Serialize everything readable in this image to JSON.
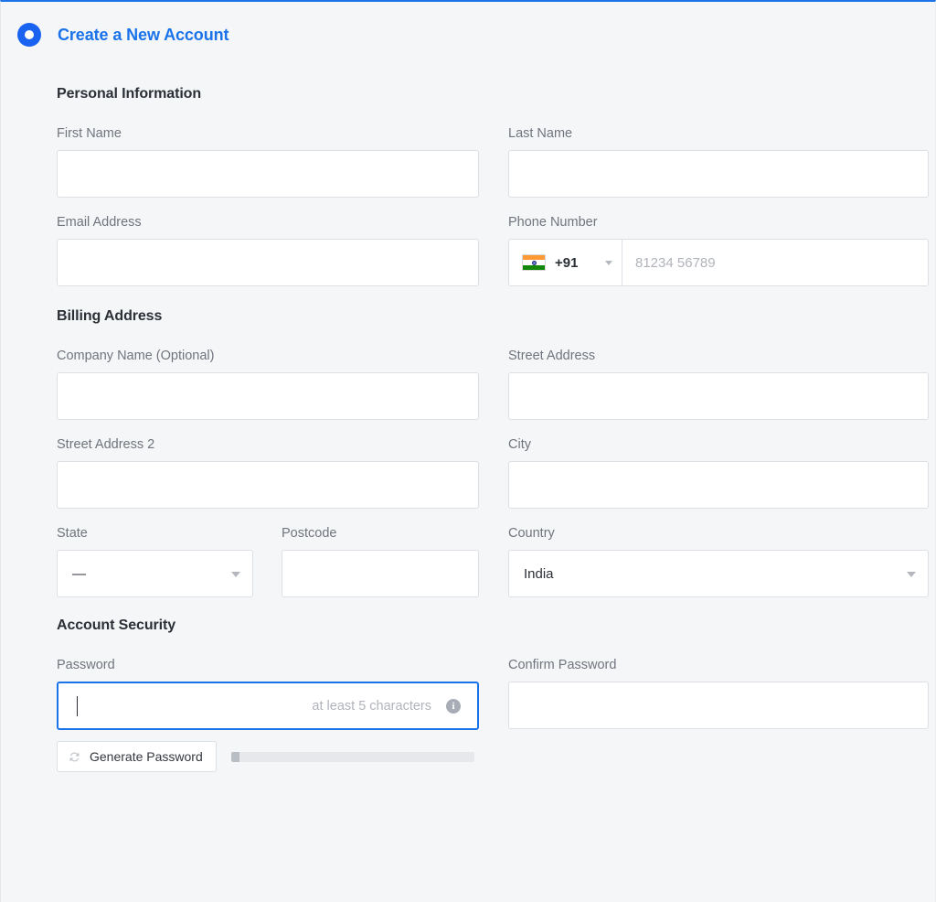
{
  "header": {
    "title": "Create a New Account",
    "radio_selected": true,
    "accent_color": "#1a73e8"
  },
  "sections": {
    "personal": {
      "title": "Personal Information"
    },
    "billing": {
      "title": "Billing Address"
    },
    "security": {
      "title": "Account Security"
    }
  },
  "fields": {
    "first_name": {
      "label": "First Name",
      "value": "",
      "placeholder": ""
    },
    "last_name": {
      "label": "Last Name",
      "value": "",
      "placeholder": ""
    },
    "email": {
      "label": "Email Address",
      "value": "",
      "placeholder": ""
    },
    "phone": {
      "label": "Phone Number",
      "dial_code": "+91",
      "flag": "india-flag-icon",
      "value": "",
      "placeholder": "81234 56789"
    },
    "company_name": {
      "label": "Company Name (Optional)",
      "value": "",
      "placeholder": ""
    },
    "street_address": {
      "label": "Street Address",
      "value": "",
      "placeholder": ""
    },
    "street_address_2": {
      "label": "Street Address 2",
      "value": "",
      "placeholder": ""
    },
    "city": {
      "label": "City",
      "value": "",
      "placeholder": ""
    },
    "state": {
      "label": "State",
      "value": "—"
    },
    "postcode": {
      "label": "Postcode",
      "value": "",
      "placeholder": ""
    },
    "country": {
      "label": "Country",
      "value": "India"
    },
    "password": {
      "label": "Password",
      "value": "",
      "hint": "at least 5 characters",
      "info_glyph": "i",
      "focused": true
    },
    "confirm_password": {
      "label": "Confirm Password",
      "value": "",
      "placeholder": ""
    }
  },
  "password_tools": {
    "generate_label": "Generate Password",
    "generate_icon": "refresh-icon",
    "strength_percent": 3,
    "strength_track_color": "#e6e8eb",
    "strength_fill_color": "#b9bdc4"
  },
  "colors": {
    "background": "#f5f6f8",
    "input_background": "#ffffff",
    "input_border": "#dcdfe3",
    "label_text": "#70757d",
    "heading_text": "#2b2f36",
    "placeholder_text": "#b0b4ba",
    "focus_border": "#1a73e8",
    "top_bar": "#1a73e8"
  }
}
